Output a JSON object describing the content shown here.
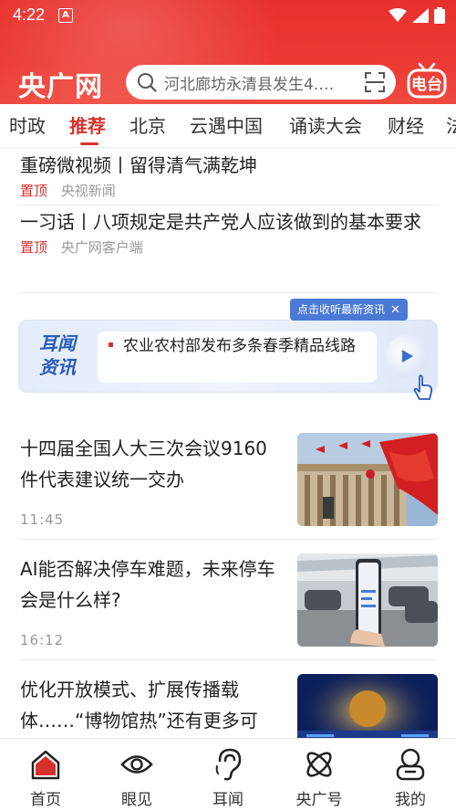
{
  "status": {
    "time": "4:22",
    "app_icon": "A"
  },
  "header": {
    "logo": "央广网",
    "search_placeholder": "河北廊坊永清县发生4.…",
    "radio_label": "电台"
  },
  "tabs": [
    "时政",
    "推荐",
    "北京",
    "云遇中国",
    "诵读大会",
    "财经",
    "法"
  ],
  "active_tab": "推荐",
  "feed": {
    "pinned": [
      {
        "title": "重磅微视频丨留得清气满乾坤",
        "pin": "置顶",
        "source": "央视新闻"
      },
      {
        "title": "一习话丨八项规定是共产党人应该做到的基本要求",
        "pin": "置顶",
        "source": "央广网客户端"
      }
    ],
    "audio": {
      "logo_line1": "耳闻",
      "logo_line2": "资讯",
      "text": "农业农村部发布多条春季精品线路",
      "hint": "点击收听最新资讯",
      "hint_close": "✕"
    },
    "articles": [
      {
        "title": "十四届全国人大三次会议9160件代表建议统一交办",
        "time": "11:45"
      },
      {
        "title": "AI能否解决停车难题，未来停车会是什么样?",
        "time": "16:12"
      },
      {
        "title": "优化开放模式、扩展传播载体……“博物馆热”还有更多可",
        "time": ""
      }
    ]
  },
  "bottom_nav": [
    "首页",
    "眼见",
    "耳闻",
    "央广号",
    "我的"
  ],
  "colors": {
    "brand_red": "#e8302b",
    "accent_red": "#d6322c",
    "audio_blue": "#2a5cb8"
  }
}
